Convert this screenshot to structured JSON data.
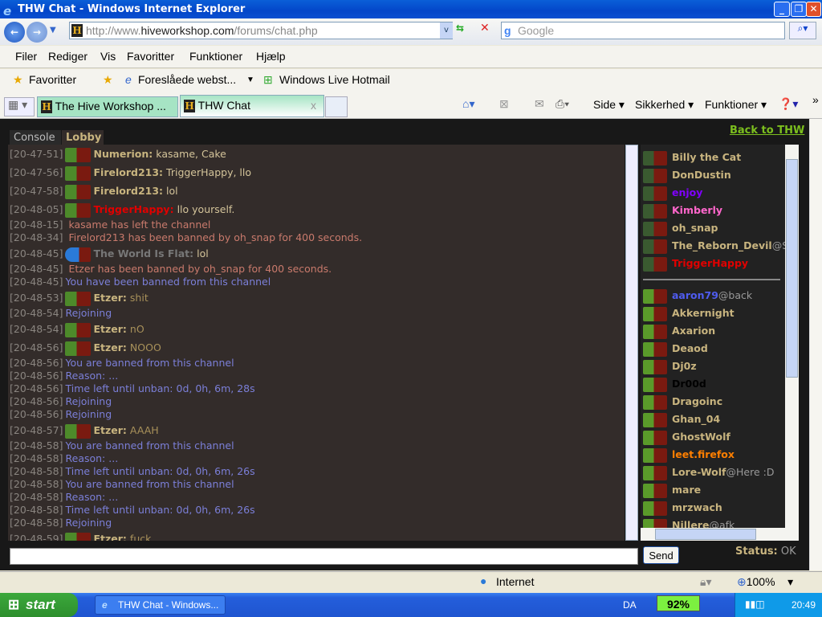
{
  "window": {
    "title": "THW Chat - Windows Internet Explorer"
  },
  "address": {
    "url_prefix": "http://www.",
    "url_host": "hiveworkshop.com",
    "url_path": "/forums/chat.php",
    "search_placeholder": "Google"
  },
  "menu": [
    "Filer",
    "Rediger",
    "Vis",
    "Favoritter",
    "Funktioner",
    "Hjælp"
  ],
  "favorites": {
    "label": "Favoritter",
    "suggested": "Foreslåede webst...",
    "hotmail": "Windows Live Hotmail"
  },
  "tabs": [
    {
      "label": "The Hive Workshop ..."
    },
    {
      "label": "THW Chat",
      "active": true
    }
  ],
  "commandbar": [
    "Side",
    "Sikkerhed",
    "Funktioner"
  ],
  "chat": {
    "tabs": [
      "Console",
      "Lobby"
    ],
    "back_link": "Back to THW",
    "messages": [
      {
        "time": "[20-47-51]",
        "avatar": "orc",
        "name": "Numerion:",
        "text": "kasame, Cake"
      },
      {
        "time": "[20-47-56]",
        "avatar": "orc",
        "name": "Firelord213:",
        "text": "TriggerHappy, llo"
      },
      {
        "time": "[20-47-58]",
        "avatar": "orc",
        "name": "Firelord213:",
        "text": "lol"
      },
      {
        "time": "[20-48-05]",
        "avatar": "orc",
        "name": "TriggerHappy:",
        "text": "llo yourself.",
        "name_color": "#e00000"
      },
      {
        "time": "[20-48-15]",
        "type": "sys",
        "text": " kasame has left the channel"
      },
      {
        "time": "[20-48-34]",
        "type": "sys",
        "text": " Firelord213 has been banned by oh_snap for 400 seconds."
      },
      {
        "time": "[20-48-45]",
        "avatar": "globe",
        "name": "The World Is Flat:",
        "text": "lol",
        "name_color": "#777777"
      },
      {
        "time": "[20-48-45]",
        "type": "sys",
        "text": " Etzer has been banned by oh_snap for 400 seconds."
      },
      {
        "time": "[20-48-45]",
        "type": "blue",
        "text": "You have been banned from this channel"
      },
      {
        "time": "[20-48-53]",
        "avatar": "orc",
        "name": "Etzer:",
        "text": "shit",
        "text_color": "#a8915a"
      },
      {
        "time": "[20-48-54]",
        "type": "blue",
        "text": "Rejoining"
      },
      {
        "time": "[20-48-54]",
        "avatar": "orc",
        "name": "Etzer:",
        "text": "nO",
        "text_color": "#a8915a"
      },
      {
        "time": "[20-48-56]",
        "avatar": "orc",
        "name": "Etzer:",
        "text": "NOOO",
        "text_color": "#a8915a"
      },
      {
        "time": "[20-48-56]",
        "type": "blue",
        "text": "You are banned from this channel"
      },
      {
        "time": "[20-48-56]",
        "type": "blue",
        "text": "Reason: ..."
      },
      {
        "time": "[20-48-56]",
        "type": "blue",
        "text": "Time left until unban: 0d, 0h, 6m, 28s"
      },
      {
        "time": "[20-48-56]",
        "type": "blue",
        "text": "Rejoining"
      },
      {
        "time": "[20-48-56]",
        "type": "blue",
        "text": "Rejoining"
      },
      {
        "time": "[20-48-57]",
        "avatar": "orc",
        "name": "Etzer:",
        "text": "AAAH",
        "text_color": "#a8915a"
      },
      {
        "time": "[20-48-58]",
        "type": "blue",
        "text": "You are banned from this channel"
      },
      {
        "time": "[20-48-58]",
        "type": "blue",
        "text": "Reason: ..."
      },
      {
        "time": "[20-48-58]",
        "type": "blue",
        "text": "Time left until unban: 0d, 0h, 6m, 26s"
      },
      {
        "time": "[20-48-58]",
        "type": "blue",
        "text": "You are banned from this channel"
      },
      {
        "time": "[20-48-58]",
        "type": "blue",
        "text": "Reason: ..."
      },
      {
        "time": "[20-48-58]",
        "type": "blue",
        "text": "Time left until unban: 0d, 0h, 6m, 26s"
      },
      {
        "time": "[20-48-58]",
        "type": "blue",
        "text": "Rejoining"
      },
      {
        "time": "[20-48-59]",
        "avatar": "orc",
        "name": "Etzer:",
        "text": "fuck",
        "text_color": "#a8915a"
      }
    ],
    "moderators": [
      {
        "name": "Billy the Cat"
      },
      {
        "name": "DonDustin"
      },
      {
        "name": "enjoy",
        "color": "#8000ff"
      },
      {
        "name": "Kimberly",
        "color": "#ff66cc"
      },
      {
        "name": "oh_snap"
      },
      {
        "name": "The_Reborn_Devil",
        "status": "@S"
      },
      {
        "name": "TriggerHappy",
        "color": "#e00000"
      }
    ],
    "users": [
      {
        "name": "aaron79",
        "status": "@back",
        "color": "#4f5cf0"
      },
      {
        "name": "Akkernight"
      },
      {
        "name": "Axarion"
      },
      {
        "name": "Deaod"
      },
      {
        "name": "Dj0z"
      },
      {
        "name": "Dr00d",
        "color": "#000000"
      },
      {
        "name": "Dragoinc"
      },
      {
        "name": "Ghan_04"
      },
      {
        "name": "GhostWolf"
      },
      {
        "name": "leet.firefox",
        "color": "#ff7f00"
      },
      {
        "name": "Lore-Wolf",
        "status": "@Here :D"
      },
      {
        "name": "mare"
      },
      {
        "name": "mrzwach"
      },
      {
        "name": "Nillere",
        "status": "@afk"
      }
    ],
    "input_value": "",
    "send_label": "Send",
    "status_label": "Status:",
    "status_value": "OK"
  },
  "statusbar": {
    "zone": "Internet",
    "zoom": "100%"
  },
  "taskbar": {
    "start": "start",
    "task": "THW Chat - Windows...",
    "lang": "DA",
    "battery": "92%",
    "clock": "20:49"
  }
}
